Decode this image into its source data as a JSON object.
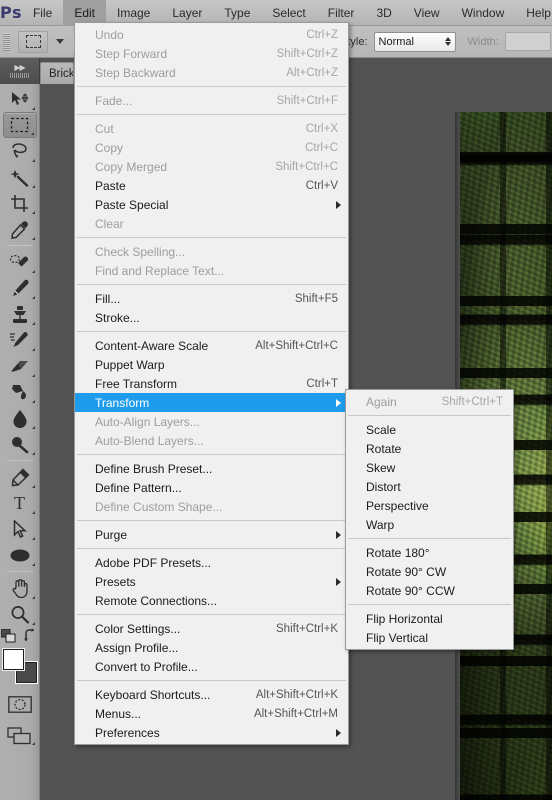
{
  "app": {
    "name": "Ps",
    "logo_color": "#3a3a6e",
    "highlight_color": "#1e9ceb"
  },
  "menubar": {
    "items": [
      {
        "label": "File",
        "active": false
      },
      {
        "label": "Edit",
        "active": true
      },
      {
        "label": "Image",
        "active": false
      },
      {
        "label": "Layer",
        "active": false
      },
      {
        "label": "Type",
        "active": false
      },
      {
        "label": "Select",
        "active": false
      },
      {
        "label": "Filter",
        "active": false
      },
      {
        "label": "3D",
        "active": false
      },
      {
        "label": "View",
        "active": false
      },
      {
        "label": "Window",
        "active": false
      },
      {
        "label": "Help",
        "active": false
      }
    ]
  },
  "options_bar": {
    "style_label": "Style:",
    "style_value": "Normal",
    "width_label": "Width:",
    "width_value": ""
  },
  "document_tabs": [
    {
      "label": "Brick",
      "active": true
    }
  ],
  "toolbar": {
    "tools": [
      {
        "name": "move-tool",
        "selected": false
      },
      {
        "name": "rectangular-marquee-tool",
        "selected": true
      },
      {
        "name": "lasso-tool",
        "selected": false
      },
      {
        "name": "magic-wand-tool",
        "selected": false
      },
      {
        "name": "crop-tool",
        "selected": false
      },
      {
        "name": "eyedropper-tool",
        "selected": false
      },
      {
        "name": "spot-healing-brush-tool",
        "selected": false
      },
      {
        "name": "brush-tool",
        "selected": false
      },
      {
        "name": "clone-stamp-tool",
        "selected": false
      },
      {
        "name": "history-brush-tool",
        "selected": false
      },
      {
        "name": "eraser-tool",
        "selected": false
      },
      {
        "name": "gradient-tool",
        "selected": false
      },
      {
        "name": "blur-tool",
        "selected": false
      },
      {
        "name": "dodge-tool",
        "selected": false
      },
      {
        "name": "pen-tool",
        "selected": false
      },
      {
        "name": "horizontal-type-tool",
        "selected": false
      },
      {
        "name": "path-selection-tool",
        "selected": false
      },
      {
        "name": "ellipse-tool",
        "selected": false
      },
      {
        "name": "hand-tool",
        "selected": false
      },
      {
        "name": "zoom-tool",
        "selected": false
      }
    ],
    "foreground_color": "#ffffff",
    "background_color": "#4a4a4a"
  },
  "edit_menu": {
    "items": [
      {
        "type": "item",
        "label": "Undo",
        "accel": "Ctrl+Z",
        "disabled": true,
        "submenu": false
      },
      {
        "type": "item",
        "label": "Step Forward",
        "accel": "Shift+Ctrl+Z",
        "disabled": true,
        "submenu": false
      },
      {
        "type": "item",
        "label": "Step Backward",
        "accel": "Alt+Ctrl+Z",
        "disabled": true,
        "submenu": false
      },
      {
        "type": "sep"
      },
      {
        "type": "item",
        "label": "Fade...",
        "accel": "Shift+Ctrl+F",
        "disabled": true,
        "submenu": false
      },
      {
        "type": "sep"
      },
      {
        "type": "item",
        "label": "Cut",
        "accel": "Ctrl+X",
        "disabled": true,
        "submenu": false
      },
      {
        "type": "item",
        "label": "Copy",
        "accel": "Ctrl+C",
        "disabled": true,
        "submenu": false
      },
      {
        "type": "item",
        "label": "Copy Merged",
        "accel": "Shift+Ctrl+C",
        "disabled": true,
        "submenu": false
      },
      {
        "type": "item",
        "label": "Paste",
        "accel": "Ctrl+V",
        "disabled": false,
        "submenu": false
      },
      {
        "type": "item",
        "label": "Paste Special",
        "accel": "",
        "disabled": false,
        "submenu": true
      },
      {
        "type": "item",
        "label": "Clear",
        "accel": "",
        "disabled": true,
        "submenu": false
      },
      {
        "type": "sep"
      },
      {
        "type": "item",
        "label": "Check Spelling...",
        "accel": "",
        "disabled": true,
        "submenu": false
      },
      {
        "type": "item",
        "label": "Find and Replace Text...",
        "accel": "",
        "disabled": true,
        "submenu": false
      },
      {
        "type": "sep"
      },
      {
        "type": "item",
        "label": "Fill...",
        "accel": "Shift+F5",
        "disabled": false,
        "submenu": false
      },
      {
        "type": "item",
        "label": "Stroke...",
        "accel": "",
        "disabled": false,
        "submenu": false
      },
      {
        "type": "sep"
      },
      {
        "type": "item",
        "label": "Content-Aware Scale",
        "accel": "Alt+Shift+Ctrl+C",
        "disabled": false,
        "submenu": false
      },
      {
        "type": "item",
        "label": "Puppet Warp",
        "accel": "",
        "disabled": false,
        "submenu": false
      },
      {
        "type": "item",
        "label": "Free Transform",
        "accel": "Ctrl+T",
        "disabled": false,
        "submenu": false
      },
      {
        "type": "item",
        "label": "Transform",
        "accel": "",
        "disabled": false,
        "submenu": true,
        "highlight": true
      },
      {
        "type": "item",
        "label": "Auto-Align Layers...",
        "accel": "",
        "disabled": true,
        "submenu": false
      },
      {
        "type": "item",
        "label": "Auto-Blend Layers...",
        "accel": "",
        "disabled": true,
        "submenu": false
      },
      {
        "type": "sep"
      },
      {
        "type": "item",
        "label": "Define Brush Preset...",
        "accel": "",
        "disabled": false,
        "submenu": false
      },
      {
        "type": "item",
        "label": "Define Pattern...",
        "accel": "",
        "disabled": false,
        "submenu": false
      },
      {
        "type": "item",
        "label": "Define Custom Shape...",
        "accel": "",
        "disabled": true,
        "submenu": false
      },
      {
        "type": "sep"
      },
      {
        "type": "item",
        "label": "Purge",
        "accel": "",
        "disabled": false,
        "submenu": true
      },
      {
        "type": "sep"
      },
      {
        "type": "item",
        "label": "Adobe PDF Presets...",
        "accel": "",
        "disabled": false,
        "submenu": false
      },
      {
        "type": "item",
        "label": "Presets",
        "accel": "",
        "disabled": false,
        "submenu": true
      },
      {
        "type": "item",
        "label": "Remote Connections...",
        "accel": "",
        "disabled": false,
        "submenu": false
      },
      {
        "type": "sep"
      },
      {
        "type": "item",
        "label": "Color Settings...",
        "accel": "Shift+Ctrl+K",
        "disabled": false,
        "submenu": false
      },
      {
        "type": "item",
        "label": "Assign Profile...",
        "accel": "",
        "disabled": false,
        "submenu": false
      },
      {
        "type": "item",
        "label": "Convert to Profile...",
        "accel": "",
        "disabled": false,
        "submenu": false
      },
      {
        "type": "sep"
      },
      {
        "type": "item",
        "label": "Keyboard Shortcuts...",
        "accel": "Alt+Shift+Ctrl+K",
        "disabled": false,
        "submenu": false
      },
      {
        "type": "item",
        "label": "Menus...",
        "accel": "Alt+Shift+Ctrl+M",
        "disabled": false,
        "submenu": false
      },
      {
        "type": "item",
        "label": "Preferences",
        "accel": "",
        "disabled": false,
        "submenu": true
      }
    ]
  },
  "transform_menu": {
    "items": [
      {
        "type": "item",
        "label": "Again",
        "accel": "Shift+Ctrl+T",
        "disabled": true,
        "submenu": false
      },
      {
        "type": "sep"
      },
      {
        "type": "item",
        "label": "Scale",
        "accel": "",
        "disabled": false,
        "submenu": false
      },
      {
        "type": "item",
        "label": "Rotate",
        "accel": "",
        "disabled": false,
        "submenu": false
      },
      {
        "type": "item",
        "label": "Skew",
        "accel": "",
        "disabled": false,
        "submenu": false
      },
      {
        "type": "item",
        "label": "Distort",
        "accel": "",
        "disabled": false,
        "submenu": false
      },
      {
        "type": "item",
        "label": "Perspective",
        "accel": "",
        "disabled": false,
        "submenu": false
      },
      {
        "type": "item",
        "label": "Warp",
        "accel": "",
        "disabled": false,
        "submenu": false
      },
      {
        "type": "sep"
      },
      {
        "type": "item",
        "label": "Rotate 180°",
        "accel": "",
        "disabled": false,
        "submenu": false
      },
      {
        "type": "item",
        "label": "Rotate 90° CW",
        "accel": "",
        "disabled": false,
        "submenu": false
      },
      {
        "type": "item",
        "label": "Rotate 90° CCW",
        "accel": "",
        "disabled": false,
        "submenu": false
      },
      {
        "type": "sep"
      },
      {
        "type": "item",
        "label": "Flip Horizontal",
        "accel": "",
        "disabled": false,
        "submenu": false
      },
      {
        "type": "item",
        "label": "Flip Vertical",
        "accel": "",
        "disabled": false,
        "submenu": false
      }
    ]
  }
}
